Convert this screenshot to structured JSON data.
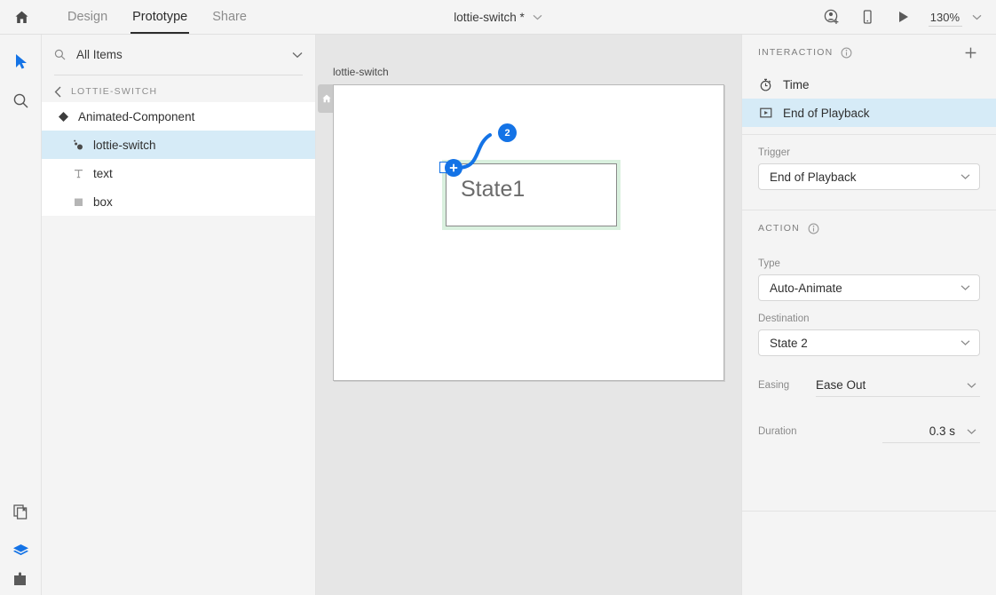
{
  "header": {
    "home_icon": "home-icon",
    "tabs": [
      {
        "label": "Design",
        "active": false
      },
      {
        "label": "Prototype",
        "active": true
      },
      {
        "label": "Share",
        "active": false
      }
    ],
    "document_title": "lottie-switch *",
    "title_chevron": "chevron-down-icon",
    "invite_icon": "invite-user-icon",
    "device_preview_icon": "mobile-device-icon",
    "play_icon": "play-icon",
    "zoom_level": "130%",
    "zoom_chevron": "chevron-down-icon"
  },
  "toolbar": {
    "items": [
      {
        "name": "select-tool",
        "icon": "cursor-arrow-icon",
        "active": true
      },
      {
        "name": "zoom-tool",
        "icon": "magnifier-icon",
        "active": false
      }
    ],
    "bottom_items": [
      {
        "name": "artboards-panel",
        "icon": "artboards-icon",
        "active": false
      },
      {
        "name": "layers-panel",
        "icon": "layers-stack-icon",
        "active": true
      },
      {
        "name": "plugins-panel",
        "icon": "plugins-icon",
        "active": false
      }
    ]
  },
  "layers_panel": {
    "search": {
      "value": "All Items",
      "placeholder": "All Items",
      "icon": "search-icon",
      "chevron": "chevron-down-icon"
    },
    "breadcrumb": {
      "back_icon": "chevron-left-icon",
      "label": "LOTTIE-SWITCH"
    },
    "items": [
      {
        "label": "Animated-Component",
        "icon": "component-diamond-icon",
        "selected": false,
        "indent": false
      },
      {
        "label": "lottie-switch",
        "icon": "lottie-animation-icon",
        "selected": true,
        "indent": true
      },
      {
        "label": "text",
        "icon": "text-layer-icon",
        "selected": false,
        "indent": true
      },
      {
        "label": "box",
        "icon": "rectangle-layer-icon",
        "selected": false,
        "indent": true
      }
    ]
  },
  "canvas": {
    "artboard_label": "lottie-switch",
    "home_icon": "home-icon",
    "component_state_label": "State1",
    "connection_badge": "2",
    "plus_handle": "plus-icon",
    "selection_color": "#d9f0de",
    "wire_color": "#1473e6"
  },
  "inspector": {
    "interaction": {
      "title": "INTERACTION",
      "info_icon": "info-icon",
      "add_icon": "plus-icon",
      "items": [
        {
          "label": "Time",
          "icon": "stopwatch-icon",
          "selected": false
        },
        {
          "label": "End of Playback",
          "icon": "end-of-playback-icon",
          "selected": true
        }
      ],
      "trigger_label": "Trigger",
      "trigger_value": "End of Playback",
      "trigger_chevron": "chevron-down-icon"
    },
    "action": {
      "title": "ACTION",
      "info_icon": "info-icon",
      "type_label": "Type",
      "type_value": "Auto-Animate",
      "type_chevron": "chevron-down-icon",
      "destination_label": "Destination",
      "destination_value": "State 2",
      "destination_chevron": "chevron-down-icon",
      "easing_label": "Easing",
      "easing_value": "Ease Out",
      "easing_chevron": "chevron-down-icon",
      "duration_label": "Duration",
      "duration_value": "0.3 s",
      "duration_chevron": "chevron-down-icon"
    }
  },
  "colors": {
    "accent_blue": "#1473e6",
    "selection_blue": "#d6ebf7",
    "panel_gray": "#f4f4f4",
    "canvas_gray": "#e6e6e6"
  }
}
